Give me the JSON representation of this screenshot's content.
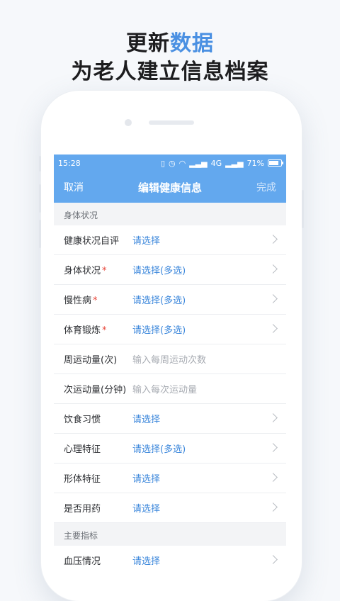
{
  "headline": {
    "part1": "更新",
    "accent": "数据",
    "line2": "为老人建立信息档案"
  },
  "status": {
    "time": "15:28",
    "network": "4G",
    "battery": "71%"
  },
  "nav": {
    "cancel": "取消",
    "title": "编辑健康信息",
    "done": "完成"
  },
  "sections": {
    "body": "身体状况",
    "main": "主要指标"
  },
  "rows": [
    {
      "label": "健康状况自评",
      "required": false,
      "value": "请选择",
      "placeholder": false,
      "chevron": true
    },
    {
      "label": "身体状况",
      "required": true,
      "value": "请选择(多选)",
      "placeholder": false,
      "chevron": true
    },
    {
      "label": "慢性病",
      "required": true,
      "value": "请选择(多选)",
      "placeholder": false,
      "chevron": true
    },
    {
      "label": "体育锻炼",
      "required": true,
      "value": "请选择(多选)",
      "placeholder": false,
      "chevron": true
    },
    {
      "label": "周运动量(次)",
      "required": false,
      "value": "输入每周运动次数",
      "placeholder": true,
      "chevron": false
    },
    {
      "label": "次运动量(分钟)",
      "required": false,
      "value": "输入每次运动量",
      "placeholder": true,
      "chevron": false
    },
    {
      "label": "饮食习惯",
      "required": false,
      "value": "请选择",
      "placeholder": false,
      "chevron": true
    },
    {
      "label": "心理特征",
      "required": false,
      "value": "请选择(多选)",
      "placeholder": false,
      "chevron": true
    },
    {
      "label": "形体特征",
      "required": false,
      "value": "请选择",
      "placeholder": false,
      "chevron": true
    },
    {
      "label": "是否用药",
      "required": false,
      "value": "请选择",
      "placeholder": false,
      "chevron": true
    }
  ],
  "rows2": [
    {
      "label": "血压情况",
      "required": false,
      "value": "请选择",
      "placeholder": false,
      "chevron": true
    }
  ],
  "required_mark": "*"
}
